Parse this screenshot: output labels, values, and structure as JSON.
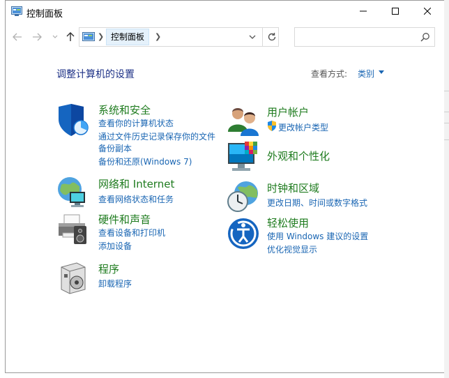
{
  "window": {
    "title": "控制面板"
  },
  "nav": {
    "breadcrumb": "控制面板",
    "search_placeholder": ""
  },
  "header": {
    "title": "调整计算机的设置",
    "view_label": "查看方式:",
    "view_value": "类别"
  },
  "categories": {
    "security": {
      "title": "系统和安全",
      "links": [
        "查看你的计算机状态",
        "通过文件历史记录保存你的文件",
        "备份副本",
        "备份和还原(Windows 7)"
      ]
    },
    "network": {
      "title": "网络和 Internet",
      "links": [
        "查看网络状态和任务"
      ]
    },
    "hardware": {
      "title": "硬件和声音",
      "links": [
        "查看设备和打印机",
        "添加设备"
      ]
    },
    "programs": {
      "title": "程序",
      "links": [
        "卸载程序"
      ]
    },
    "users": {
      "title": "用户帐户",
      "links": [
        "更改帐户类型"
      ]
    },
    "appearance": {
      "title": "外观和个性化",
      "links": []
    },
    "clock": {
      "title": "时钟和区域",
      "links": [
        "更改日期、时间或数字格式"
      ]
    },
    "ease": {
      "title": "轻松使用",
      "links": [
        "使用 Windows 建议的设置",
        "优化视觉显示"
      ]
    }
  },
  "colors": {
    "category_title": "#1e7b1e",
    "link": "#1a66b3",
    "heading": "#1e3287"
  }
}
